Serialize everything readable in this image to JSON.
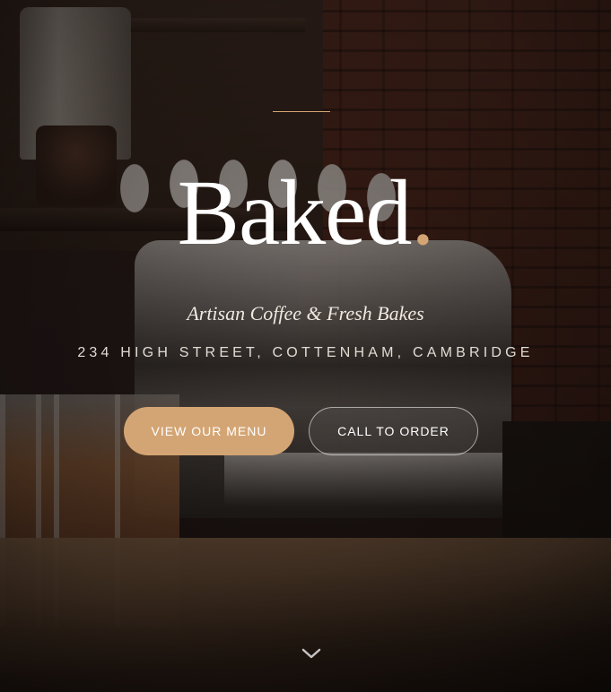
{
  "hero": {
    "brand_name": "Baked",
    "brand_dot": ".",
    "tagline": "Artisan Coffee & Fresh Bakes",
    "address": "234 HIGH STREET, COTTENHAM, CAMBRIDGE",
    "buttons": {
      "menu_label": "VIEW OUR MENU",
      "call_label": "CALL TO ORDER"
    },
    "scroll_icon": "chevron-down-icon"
  },
  "colors": {
    "accent": "#d4a574",
    "text": "#ffffff"
  }
}
